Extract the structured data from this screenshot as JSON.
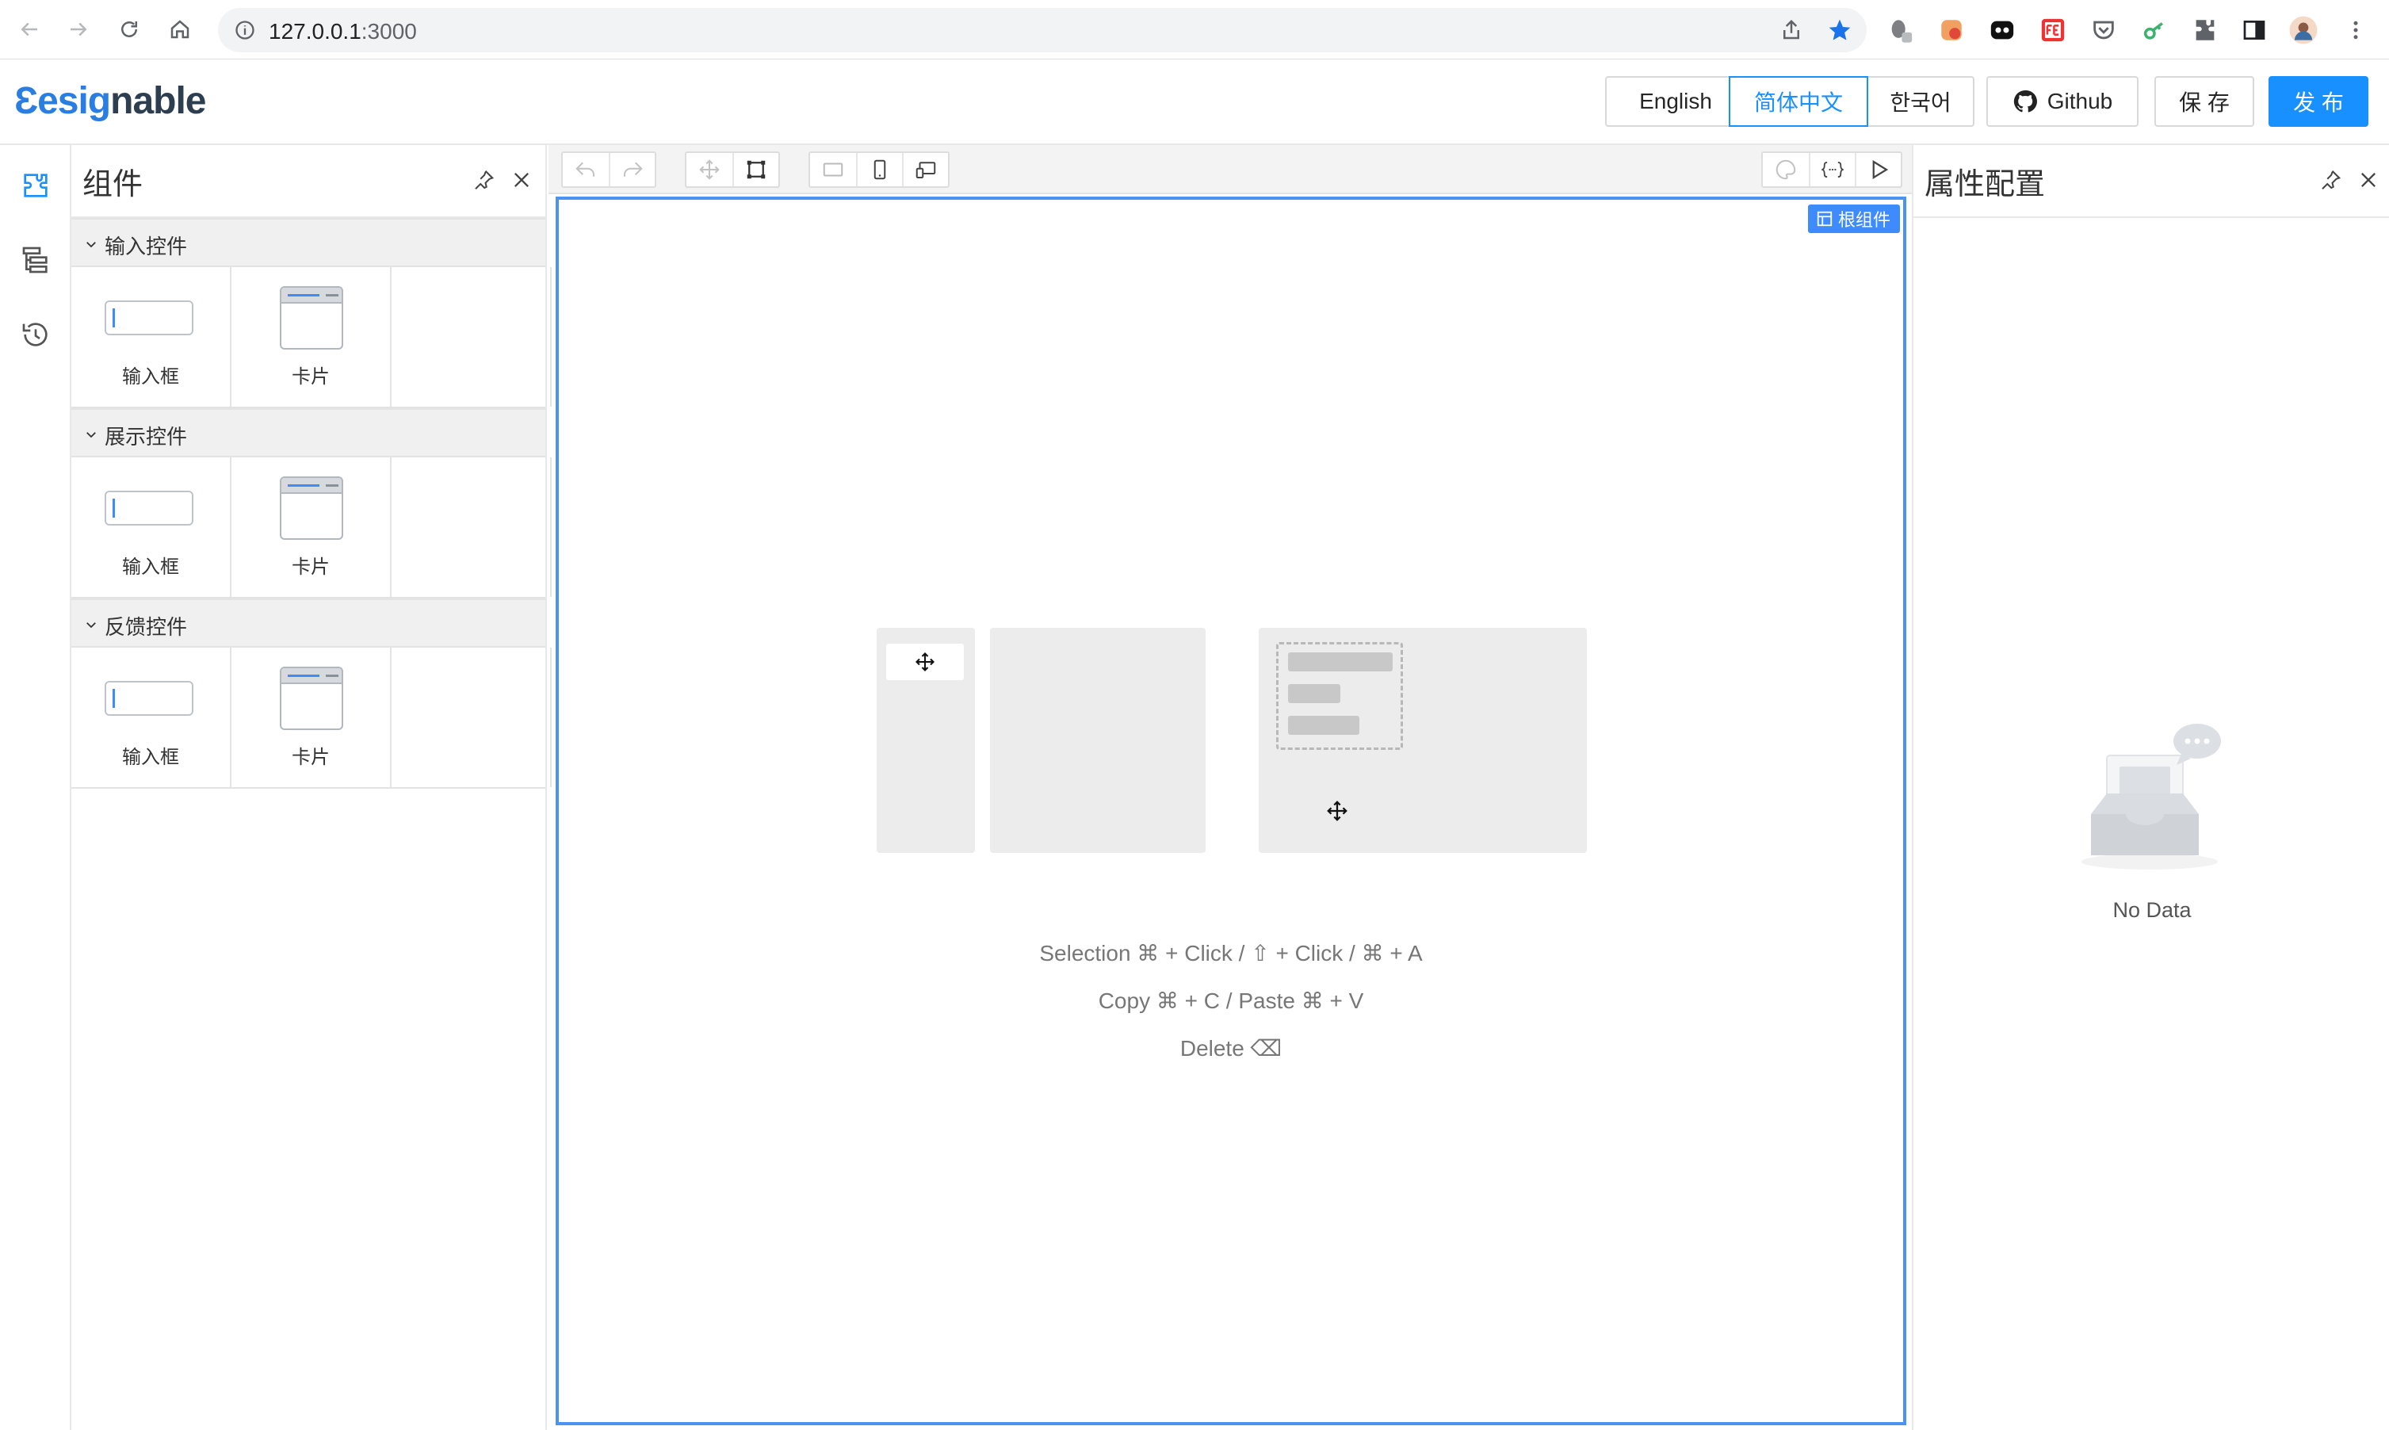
{
  "browser": {
    "url_host": "127.0.0.1",
    "url_port": ":3000"
  },
  "header": {
    "logo_prefix": "Ɛesig",
    "logo_suffix": "nable",
    "lang_buttons": [
      "English",
      "简体中文",
      "한국어"
    ],
    "active_language": "简体中文",
    "github_label": "Github",
    "save_label": "保 存",
    "publish_label": "发 布"
  },
  "components_panel": {
    "title": "组件",
    "groups": [
      {
        "title": "输入控件",
        "items": [
          {
            "label": "输入框",
            "icon": "input-box-icon"
          },
          {
            "label": "卡片",
            "icon": "card-icon"
          }
        ]
      },
      {
        "title": "展示控件",
        "items": [
          {
            "label": "输入框",
            "icon": "input-box-icon"
          },
          {
            "label": "卡片",
            "icon": "card-icon"
          }
        ]
      },
      {
        "title": "反馈控件",
        "items": [
          {
            "label": "输入框",
            "icon": "input-box-icon"
          },
          {
            "label": "卡片",
            "icon": "card-icon"
          }
        ]
      }
    ]
  },
  "canvas": {
    "root_badge": "根组件",
    "hints": [
      "Selection ⌘ + Click / ⇧ + Click / ⌘ + A",
      "Copy ⌘ + C / Paste ⌘ + V",
      "Delete ⌫"
    ]
  },
  "property_panel": {
    "title": "属性配置",
    "empty_text": "No Data"
  },
  "colors": {
    "accent": "#1890ff",
    "canvas_border": "#4a93f0"
  }
}
